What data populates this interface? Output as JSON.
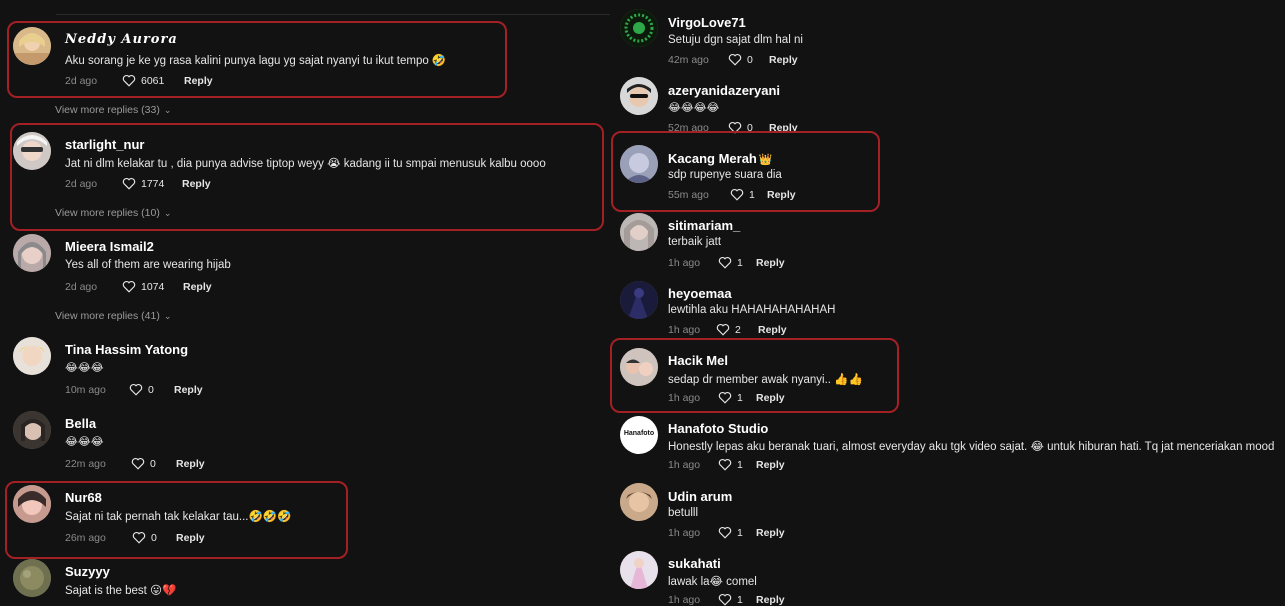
{
  "left": {
    "comments": [
      {
        "user": "𝑵𝒆𝒅𝒅𝒚 𝑨𝒖𝒓𝒐𝒓𝒂",
        "text": "Aku sorang je ke yg rasa kalini punya lagu yg sajat nyanyi tu ikut tempo 🤣",
        "time": "2d ago",
        "likes": "6061",
        "reply": "Reply"
      },
      {
        "user": "starlight_nur",
        "text": "Jat ni dlm kelakar tu , dia punya advise tiptop weyy 😭  kadang ii tu smpai menusuk kalbu oooo",
        "time": "2d ago",
        "likes": "1774",
        "reply": "Reply"
      },
      {
        "user": "Mieera Ismail2",
        "text": "Yes all of them are wearing hijab",
        "time": "2d ago",
        "likes": "1074",
        "reply": "Reply"
      },
      {
        "user": "Tina Hassim Yatong",
        "text": "😂😂😂",
        "time": "10m ago",
        "likes": "0",
        "reply": "Reply"
      },
      {
        "user": "Bella",
        "text": "😂😂😂",
        "time": "22m ago",
        "likes": "0",
        "reply": "Reply"
      },
      {
        "user": "Nur68",
        "text": "Sajat ni tak pernah tak kelakar tau...🤣🤣🤣",
        "time": "26m ago",
        "likes": "0",
        "reply": "Reply"
      },
      {
        "user": "Suzyyy",
        "text": "Sajat is the best 😛💔"
      }
    ],
    "view_more": [
      "View more replies (33)",
      "View more replies (10)",
      "View more replies (41)"
    ]
  },
  "right": {
    "comments": [
      {
        "user": "VirgoLove71",
        "text": "Setuju dgn sajat dlm hal ni",
        "time": "42m ago",
        "likes": "0",
        "reply": "Reply"
      },
      {
        "user": "azeryanidazeryani",
        "text": "😂😂😂😂",
        "time": "52m ago",
        "likes": "0",
        "reply": "Reply"
      },
      {
        "user": "Kacang Merah",
        "crown": "👑",
        "text": "sdp rupenye suara dia",
        "time": "55m ago",
        "likes": "1",
        "reply": "Reply"
      },
      {
        "user": "sitimariam_",
        "text": "terbaik jatt",
        "time": "1h ago",
        "likes": "1",
        "reply": "Reply"
      },
      {
        "user": "heyoemaa",
        "text": "lewtihla aku HAHAHAHAHAHAH",
        "time": "1h ago",
        "likes": "2",
        "reply": "Reply"
      },
      {
        "user": "Hacik Mel",
        "text": "sedap dr member awak nyanyi.. 👍👍",
        "time": "1h ago",
        "likes": "1",
        "reply": "Reply"
      },
      {
        "user": "Hanafoto Studio",
        "avatar_text": "Hanafoto",
        "text": "Honestly lepas aku beranak tuari, almost everyday aku tgk video sajat. 😂  untuk hiburan hati. Tq jat menceriakan mood",
        "time": "1h ago",
        "likes": "1",
        "reply": "Reply"
      },
      {
        "user": "Udin arum",
        "text": "betulll",
        "time": "1h ago",
        "likes": "1",
        "reply": "Reply"
      },
      {
        "user": "sukahati",
        "text": "lawak la😂  comel",
        "time": "1h ago",
        "likes": "1",
        "reply": "Reply"
      }
    ]
  },
  "colors": {
    "background": "#121212",
    "highlight": "#a32025",
    "muted": "#8a8a8a"
  }
}
